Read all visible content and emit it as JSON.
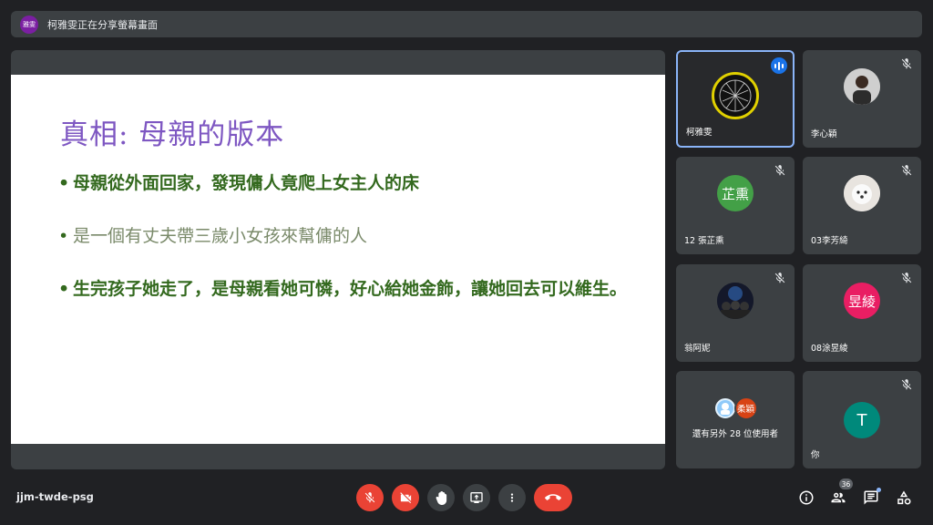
{
  "banner": {
    "avatar_text": "雅雯",
    "text": "柯雅雯正在分享螢幕畫面"
  },
  "slide": {
    "title": "真相: 母親的版本",
    "bullets": [
      "母親從外面回家，發現傭人竟爬上女主人的床",
      "是一個有丈夫帶三歲小女孩來幫傭的人",
      "生完孩子她走了，是母親看她可憐，好心給她金飾，讓她回去可以維生。"
    ]
  },
  "participants": [
    {
      "name": "柯雅雯",
      "avatar": "",
      "speaking": true
    },
    {
      "name": "李心穎",
      "avatar": "",
      "muted": true
    },
    {
      "name": "12 張芷熏",
      "avatar": "芷熏",
      "avatar_color": "#43a047",
      "muted": true
    },
    {
      "name": "03李芳綺",
      "avatar": "",
      "muted": true
    },
    {
      "name": "翁阿妮",
      "avatar": "",
      "muted": true
    },
    {
      "name": "08涂昱綾",
      "avatar": "昱綾",
      "avatar_color": "#e91e63",
      "muted": true
    },
    {
      "name": "還有另外 28 位使用者",
      "avatar": "柔穎",
      "avatar_color": "#d84315"
    },
    {
      "name": "你",
      "avatar": "T",
      "avatar_color": "#00897b",
      "muted": true
    }
  ],
  "bottom": {
    "meeting_code": "jjm-twde-psg",
    "participant_count": "36"
  },
  "icons": {
    "mic": "mic-off-icon",
    "camera": "videocam-off-icon",
    "hand": "raise-hand-icon",
    "present": "present-screen-icon",
    "more": "more-vert-icon",
    "hangup": "call-end-icon",
    "info": "info-icon",
    "people": "people-icon",
    "chat": "chat-icon",
    "activities": "activities-icon"
  },
  "colors": {
    "accent_red": "#ea4335",
    "speaking_border": "#8ab4f8",
    "slide_title": "#7e57c2",
    "slide_text": "#33691e"
  }
}
